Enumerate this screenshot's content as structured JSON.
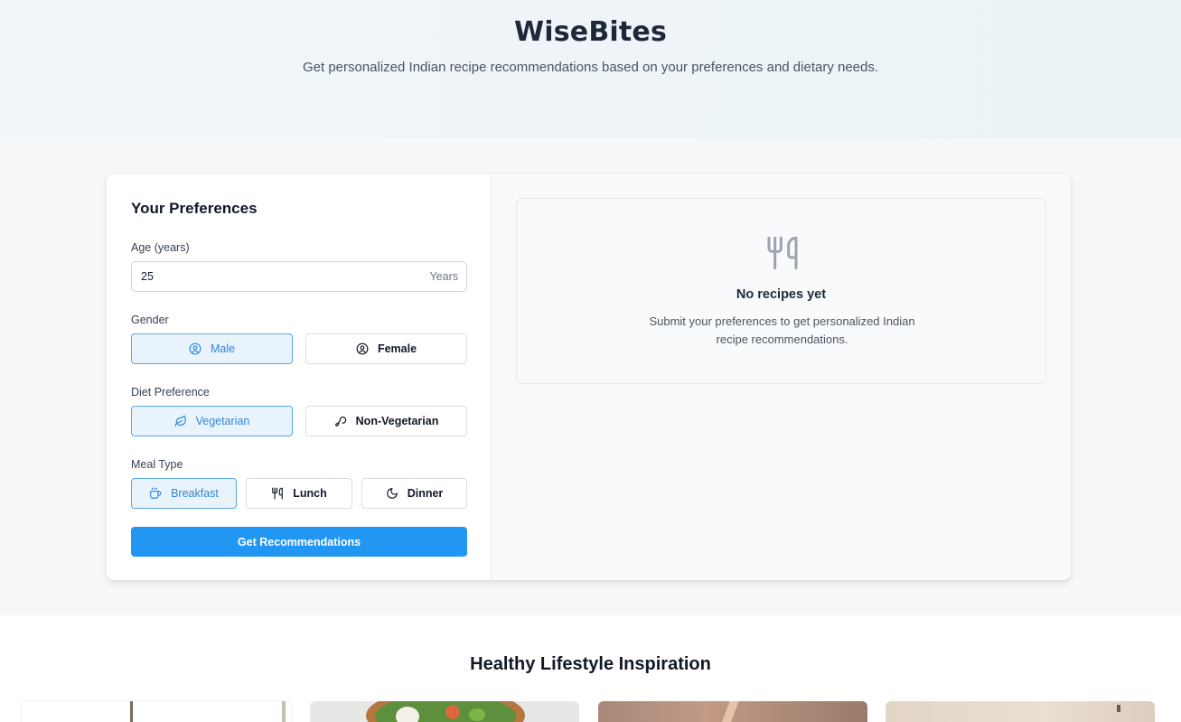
{
  "header": {
    "title": "WiseBites",
    "subtitle": "Get personalized Indian recipe recommendations based on your preferences and dietary needs."
  },
  "preferences": {
    "heading": "Your Preferences",
    "age": {
      "label": "Age (years)",
      "value": "25",
      "suffix": "Years"
    },
    "gender": {
      "label": "Gender",
      "selected": "Male",
      "options": [
        {
          "label": "Male",
          "icon": "user-circle-icon"
        },
        {
          "label": "Female",
          "icon": "user-circle-icon"
        }
      ]
    },
    "diet": {
      "label": "Diet Preference",
      "selected": "Vegetarian",
      "options": [
        {
          "label": "Vegetarian",
          "icon": "leaf-icon"
        },
        {
          "label": "Non-Vegetarian",
          "icon": "drumstick-icon"
        }
      ]
    },
    "meal": {
      "label": "Meal Type",
      "selected": "Breakfast",
      "options": [
        {
          "label": "Breakfast",
          "icon": "coffee-icon"
        },
        {
          "label": "Lunch",
          "icon": "utensils-icon"
        },
        {
          "label": "Dinner",
          "icon": "moon-icon"
        }
      ]
    },
    "submit_label": "Get Recommendations"
  },
  "results": {
    "icon": "utensils-icon",
    "empty_title": "No recipes yet",
    "empty_text": "Submit your preferences to get personalized Indian recipe recommendations."
  },
  "inspiration": {
    "heading": "Healthy Lifestyle Inspiration",
    "images": [
      "inspiration-image-1",
      "inspiration-image-2",
      "inspiration-image-3",
      "inspiration-image-4"
    ]
  },
  "colors": {
    "accent": "#2196f3",
    "active_bg": "#e9f3fc",
    "active_border": "#5aa6e6",
    "active_text": "#2f88d8"
  }
}
